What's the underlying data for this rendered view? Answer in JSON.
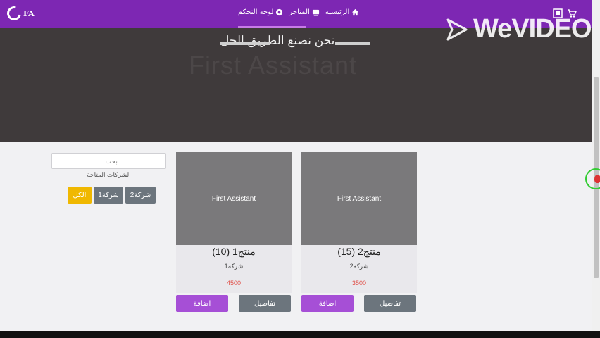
{
  "navbar": {
    "brand": "FA",
    "links": [
      {
        "label": "لوحة التحكم",
        "icon": "dashboard-icon"
      },
      {
        "label": "المتاجر",
        "icon": "store-icon"
      },
      {
        "label": "الرئيسية",
        "icon": "home-icon"
      }
    ],
    "right_icons": [
      "qr-icon",
      "cart-icon"
    ],
    "accent": "#7d27b3"
  },
  "hero": {
    "background_text": "First Assistant",
    "title": "نحن نصنع الطريق الحل"
  },
  "watermark": {
    "text": "WeVIDEO"
  },
  "filter": {
    "search_placeholder": "بحث...",
    "companies_label": "الشركات المتاحة",
    "buttons": [
      {
        "label": "شركة2",
        "color": "#6c757d"
      },
      {
        "label": "شركة1",
        "color": "#6c757d"
      },
      {
        "label": "الكل",
        "color": "#f0b800"
      }
    ]
  },
  "products": [
    {
      "title": "منتج1 (10)",
      "company": "شركة1",
      "price": "4500",
      "image_label": "First Assistant",
      "add_label": "اضافة",
      "details_label": "تفاصيل"
    },
    {
      "title": "منتج2 (15)",
      "company": "شركة2",
      "price": "3500",
      "image_label": "First Assistant",
      "add_label": "اضافة",
      "details_label": "تفاصيل"
    }
  ],
  "colors": {
    "add_button": "#a64fd6",
    "details_button": "#6c757d",
    "price": "#e0524b"
  }
}
